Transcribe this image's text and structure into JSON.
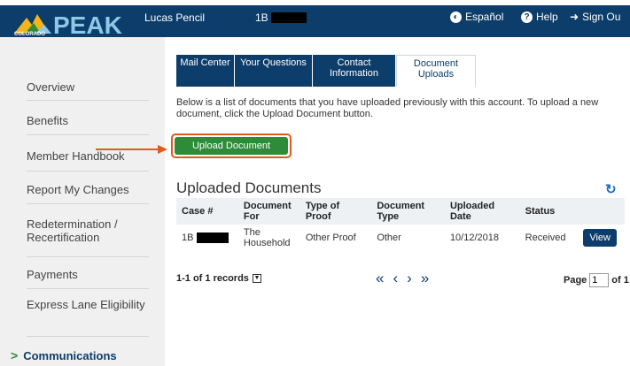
{
  "header": {
    "logo": {
      "state": "COLORADO",
      "name": "PEAK"
    },
    "user_name": "Lucas Pencil",
    "case_prefix": "1B",
    "links": {
      "espanol": "Español",
      "help": "Help",
      "signout": "Sign Ou"
    },
    "icons": {
      "espanol": "globe-icon",
      "help": "question-circle-icon",
      "signout": "sign-out-icon"
    }
  },
  "sidebar": {
    "items": [
      {
        "label": "Overview"
      },
      {
        "label": "Benefits"
      },
      {
        "label": "Member Handbook"
      },
      {
        "label": "Report My Changes"
      },
      {
        "label": "Redetermination / Recertification"
      },
      {
        "label": "Payments"
      },
      {
        "label": "Express Lane Eligibility"
      },
      {
        "label": "Communications",
        "active": true
      }
    ]
  },
  "tabs": [
    {
      "label": "Mail Center"
    },
    {
      "label": "Your Questions"
    },
    {
      "label": "Contact Information"
    },
    {
      "label": "Document Uploads",
      "active": true
    }
  ],
  "intro": "Below is a list of documents that you have uploaded previously with this account. To upload a new document, click the Upload Document button.",
  "upload_label": "Upload Document",
  "section_title": "Uploaded Documents",
  "table": {
    "headers": [
      "Case #",
      "Document For",
      "Type of Proof",
      "Document Type",
      "Uploaded Date",
      "Status"
    ],
    "rows": [
      {
        "case": "1B",
        "for": "The Household",
        "proof": "Other Proof",
        "type": "Other",
        "date": "10/12/2018",
        "status": "Received",
        "action": "View"
      }
    ]
  },
  "records": "1-1 of 1 records",
  "pager": {
    "first": "«",
    "prev": "‹",
    "next": "›",
    "last": "»"
  },
  "page": {
    "label": "Page",
    "current": "1",
    "total": "of 1"
  },
  "colors": {
    "navy": "#0d3d6b",
    "green": "#2e8b3a",
    "highlight": "#e05a1c",
    "refresh": "#1e6ad4"
  }
}
